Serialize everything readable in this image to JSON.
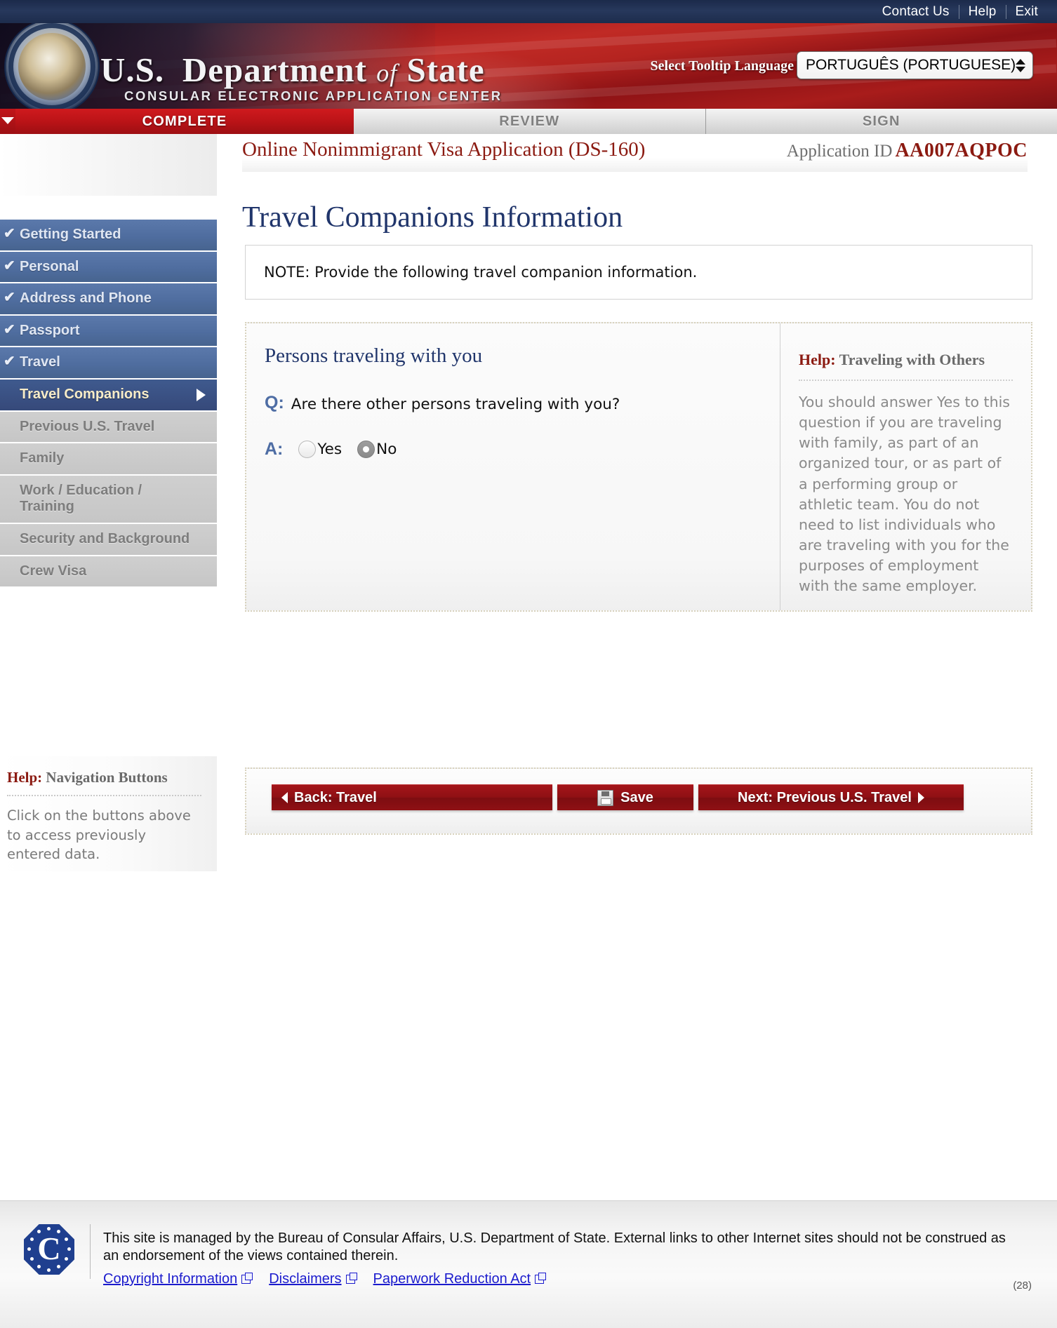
{
  "topbar": {
    "links": [
      "Contact Us",
      "Help",
      "Exit"
    ]
  },
  "banner": {
    "org_line1": "U.S. D",
    "org_title_us": "U.S.",
    "org_title_dept": "Department",
    "org_title_of": "of",
    "org_title_state": "State",
    "subtitle": "CONSULAR ELECTRONIC APPLICATION CENTER",
    "language_label": "Select Tooltip Language",
    "language_value": "PORTUGUÊS (PORTUGUESE)",
    "seal_name": "us-department-of-state-seal"
  },
  "tabs": [
    {
      "label": "COMPLETE",
      "state": "active"
    },
    {
      "label": "REVIEW",
      "state": "idle"
    },
    {
      "label": "SIGN",
      "state": "idle"
    }
  ],
  "sidebar": {
    "items": [
      {
        "label": "Getting Started",
        "state": "done"
      },
      {
        "label": "Personal",
        "state": "done"
      },
      {
        "label": "Address and Phone",
        "state": "done"
      },
      {
        "label": "Passport",
        "state": "done"
      },
      {
        "label": "Travel",
        "state": "done"
      },
      {
        "label": "Travel Companions",
        "state": "current"
      },
      {
        "label": "Previous U.S. Travel",
        "state": "pending"
      },
      {
        "label": "Family",
        "state": "pending"
      },
      {
        "label": "Work / Education / Training",
        "state": "pending"
      },
      {
        "label": "Security and Background",
        "state": "pending"
      },
      {
        "label": "Crew Visa",
        "state": "pending"
      }
    ],
    "help": {
      "title_prefix": "Help:",
      "title": "Navigation Buttons",
      "body": "Click on the buttons above to access previously entered data."
    }
  },
  "main": {
    "app_title": "Online Nonimmigrant Visa Application (DS-160)",
    "app_id_label": "Application ID",
    "app_id_value": "AA007AQPOC",
    "page_title": "Travel Companions Information",
    "note": "NOTE: Provide the following travel companion information.",
    "section_heading": "Persons traveling with you",
    "question_marker": "Q:",
    "question": "Are there other persons traveling with you?",
    "answer_marker": "A:",
    "options": [
      {
        "label": "Yes",
        "selected": false
      },
      {
        "label": "No",
        "selected": true
      }
    ],
    "help": {
      "title_prefix": "Help:",
      "title": "Traveling with Others",
      "body": "You should answer Yes to this question if you are traveling with family, as part of an organized tour, or as part of a performing group or athletic team. You do not need to list individuals who are traveling with you for the purposes of employment with the same employer."
    },
    "buttons": {
      "back": "Back: Travel",
      "save": "Save",
      "next": "Next: Previous U.S. Travel"
    }
  },
  "footer": {
    "logo_letter": "C",
    "text": "This site is managed by the Bureau of Consular Affairs, U.S. Department of State. External links to other Internet sites should not be construed as an endorsement of the views contained therein.",
    "links": [
      "Copyright Information",
      "Disclaimers",
      "Paperwork Reduction Act"
    ],
    "page_number": "(28)"
  },
  "colors": {
    "brand_red": "#8f1014",
    "brand_navy": "#20356b",
    "nav_done": "#4f6d9f",
    "nav_current": "#3a5184",
    "nav_pending": "#c9c9c9",
    "link_blue": "#1b1bcd"
  }
}
